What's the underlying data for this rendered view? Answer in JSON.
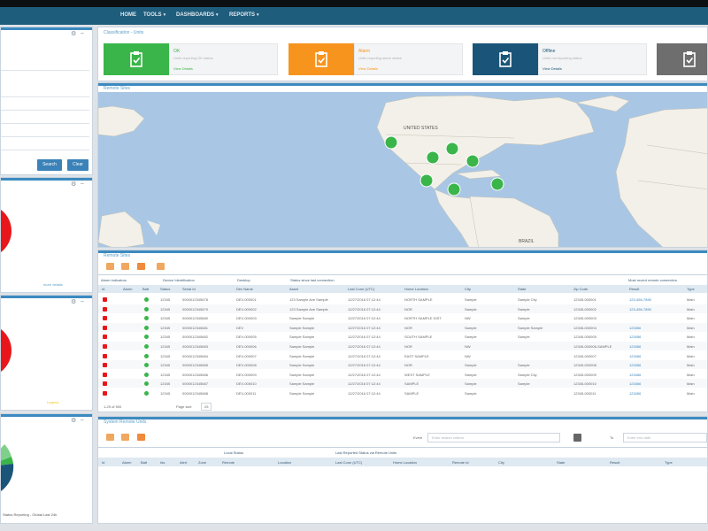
{
  "nav": {
    "items": [
      {
        "label": "HOME",
        "caret": ""
      },
      {
        "label": "TOOLS",
        "caret": "▾"
      },
      {
        "label": "DASHBOARDS",
        "caret": "▾"
      },
      {
        "label": "REPORTS",
        "caret": "▾"
      }
    ]
  },
  "colors": {
    "nav": "#1f5d7c",
    "accent": "#3d8ac0",
    "status_red": "#e8161b",
    "status_green": "#3ab54a",
    "status_orange": "#f7941d",
    "status_navy": "#1a5579",
    "status_gray": "#6e6e6e"
  },
  "left_panels": {
    "filter": {
      "search_button": "Search",
      "clear_button": "Clear",
      "fields": [
        "",
        "",
        "",
        "",
        "",
        ""
      ]
    },
    "chart2": {
      "link": "more details"
    },
    "chart3": {
      "label": "Legend"
    },
    "chart4": {
      "caption": "Status Reporting - Global Last 24h"
    }
  },
  "classification": {
    "title": "Classification - Units",
    "tiles": [
      {
        "title": "OK",
        "subtitle": "Units reporting OK status",
        "footer": "View Details",
        "color": "#3ab54a",
        "text_color": "#3ab54a",
        "icon": "clipboard-check-icon"
      },
      {
        "title": "Alarm",
        "subtitle": "Units reporting alarm status",
        "footer": "View Details",
        "color": "#f7941d",
        "text_color": "#f7941d",
        "icon": "clipboard-check-icon"
      },
      {
        "title": "Offline",
        "subtitle": "Units not reporting status",
        "footer": "View Details",
        "color": "#1a5579",
        "text_color": "#1a5579",
        "icon": "clipboard-check-icon"
      },
      {
        "title": "",
        "subtitle": "",
        "footer": "",
        "color": "#6e6e6e",
        "text_color": "#6e6e6e",
        "icon": "clipboard-check-icon"
      }
    ]
  },
  "map": {
    "title": "Remote Sites",
    "labels": [
      "UNITED STATES",
      "BRAZIL"
    ]
  },
  "remote_sites": {
    "title": "Remote Sites",
    "group_headers": [
      "Alarm Indicators",
      "Device Identification",
      "Desktop",
      "Status since last connection",
      "Most recent remote connection"
    ],
    "columns": [
      "Id",
      "Alarm",
      "Batt",
      "Status",
      "Serial Id",
      "Dev Name",
      "Asset",
      "Last Conn (UTC)",
      "Home Location",
      "City",
      "State",
      "Zip Code",
      "Result",
      "Type"
    ],
    "rows": [
      {
        "status_light": "#e8161b",
        "conn_light": "#3ab54a",
        "status": "12345",
        "serial": "0000012345678",
        "devname": "DEV-000001",
        "asset": "123 Sample Ave Sample",
        "lastconn": "12/27/2016 07:12:44",
        "home": "NORTH SAMPLE",
        "city": "Sample",
        "state": "Sample City",
        "zip": "12345-000001",
        "result": "123-456-7890",
        "type": "Main"
      },
      {
        "status_light": "#e8161b",
        "conn_light": "#3ab54a",
        "status": "12345",
        "serial": "0000012345679",
        "devname": "DEV-000002",
        "asset": "123 Sample Ave Sample",
        "lastconn": "12/27/2016 07:12:44",
        "home": "NOR",
        "city": "Sample",
        "state": "Sample",
        "zip": "12345-000002",
        "result": "123-456-7890",
        "type": "Main"
      },
      {
        "status_light": "#e8161b",
        "conn_light": "#3ab54a",
        "status": "12345",
        "serial": "0000012345680",
        "devname": "DEV-000003",
        "asset": "Sample Sample",
        "lastconn": "12/27/2016 07:12:44",
        "home": "NORTH SAMPLE DIST",
        "city": "NW",
        "state": "Sample",
        "zip": "12345-000003",
        "result": "",
        "type": "Main"
      },
      {
        "status_light": "#e8161b",
        "conn_light": "#3ab54a",
        "status": "12345",
        "serial": "0000012345681",
        "devname": "DEV",
        "asset": "Sample Sample",
        "lastconn": "12/27/2016 07:12:44",
        "home": "NOR",
        "city": "Sample",
        "state": "Sample Sample",
        "zip": "12345-000004",
        "result": "123456",
        "type": "Main"
      },
      {
        "status_light": "#e8161b",
        "conn_light": "#3ab54a",
        "status": "12345",
        "serial": "0000012345682",
        "devname": "DEV-000005",
        "asset": "Sample Sample",
        "lastconn": "12/27/2016 07:12:44",
        "home": "SOUTH SAMPLE",
        "city": "Sample",
        "state": "Sample",
        "zip": "12345-000005",
        "result": "123456",
        "type": "Main"
      },
      {
        "status_light": "#e8161b",
        "conn_light": "#3ab54a",
        "status": "12345",
        "serial": "0000012345683",
        "devname": "DEV-000006",
        "asset": "Sample Sample",
        "lastconn": "12/27/2016 07:12:44",
        "home": "NOR",
        "city": "NW",
        "state": "",
        "zip": "12345-000006-SAMPLE",
        "result": "123456",
        "type": "Main"
      },
      {
        "status_light": "#e8161b",
        "conn_light": "#3ab54a",
        "status": "12345",
        "serial": "0000012345684",
        "devname": "DEV-000007",
        "asset": "Sample Sample",
        "lastconn": "12/27/2016 07:12:44",
        "home": "EAST SAMPLE",
        "city": "NW",
        "state": "",
        "zip": "12345-000007",
        "result": "123456",
        "type": "Main"
      },
      {
        "status_light": "#e8161b",
        "conn_light": "#3ab54a",
        "status": "12345",
        "serial": "0000012345685",
        "devname": "DEV-000008",
        "asset": "Sample Sample",
        "lastconn": "12/27/2016 07:12:44",
        "home": "NOR",
        "city": "Sample",
        "state": "Sample",
        "zip": "12345-000008",
        "result": "123456",
        "type": "Main"
      },
      {
        "status_light": "#e8161b",
        "conn_light": "#3ab54a",
        "status": "12345",
        "serial": "0000012345686",
        "devname": "DEV-000009",
        "asset": "Sample Sample",
        "lastconn": "12/27/2016 07:12:44",
        "home": "WEST SAMPLE",
        "city": "Sample",
        "state": "Sample City",
        "zip": "12345-000009",
        "result": "123456",
        "type": "Main"
      },
      {
        "status_light": "#e8161b",
        "conn_light": "#3ab54a",
        "status": "12345",
        "serial": "0000012345687",
        "devname": "DEV-000010",
        "asset": "Sample Sample",
        "lastconn": "12/27/2016 07:12:44",
        "home": "SAMPLE",
        "city": "Sample",
        "state": "Sample",
        "zip": "12345-000010",
        "result": "123456",
        "type": "Main"
      },
      {
        "status_light": "#e8161b",
        "conn_light": "#3ab54a",
        "status": "12345",
        "serial": "0000012345688",
        "devname": "DEV-000011",
        "asset": "Sample Sample",
        "lastconn": "12/27/2016 07:12:44",
        "home": "SAMPLE",
        "city": "Sample",
        "state": "",
        "zip": "12345-000011",
        "result": "123456",
        "type": "Main"
      }
    ],
    "footer_left": "1-25 of 500",
    "page_label": "Page size",
    "page_size": "25"
  },
  "system_events": {
    "title": "System Remote Units",
    "search_label": "Event",
    "search_placeholder": "Enter search criteria",
    "to_label": "To",
    "to_placeholder": "Enter end date",
    "group_headers": [
      "Local Status",
      "Last Reported Status via Remote Units"
    ],
    "columns": [
      "Id",
      "Alarm",
      "Batt",
      "Ids",
      "Alert",
      "Zone",
      "Remote",
      "Location",
      "Last Conn (UTC)",
      "Home Location",
      "Remote Id",
      "City",
      "State",
      "Result",
      "Type"
    ]
  }
}
